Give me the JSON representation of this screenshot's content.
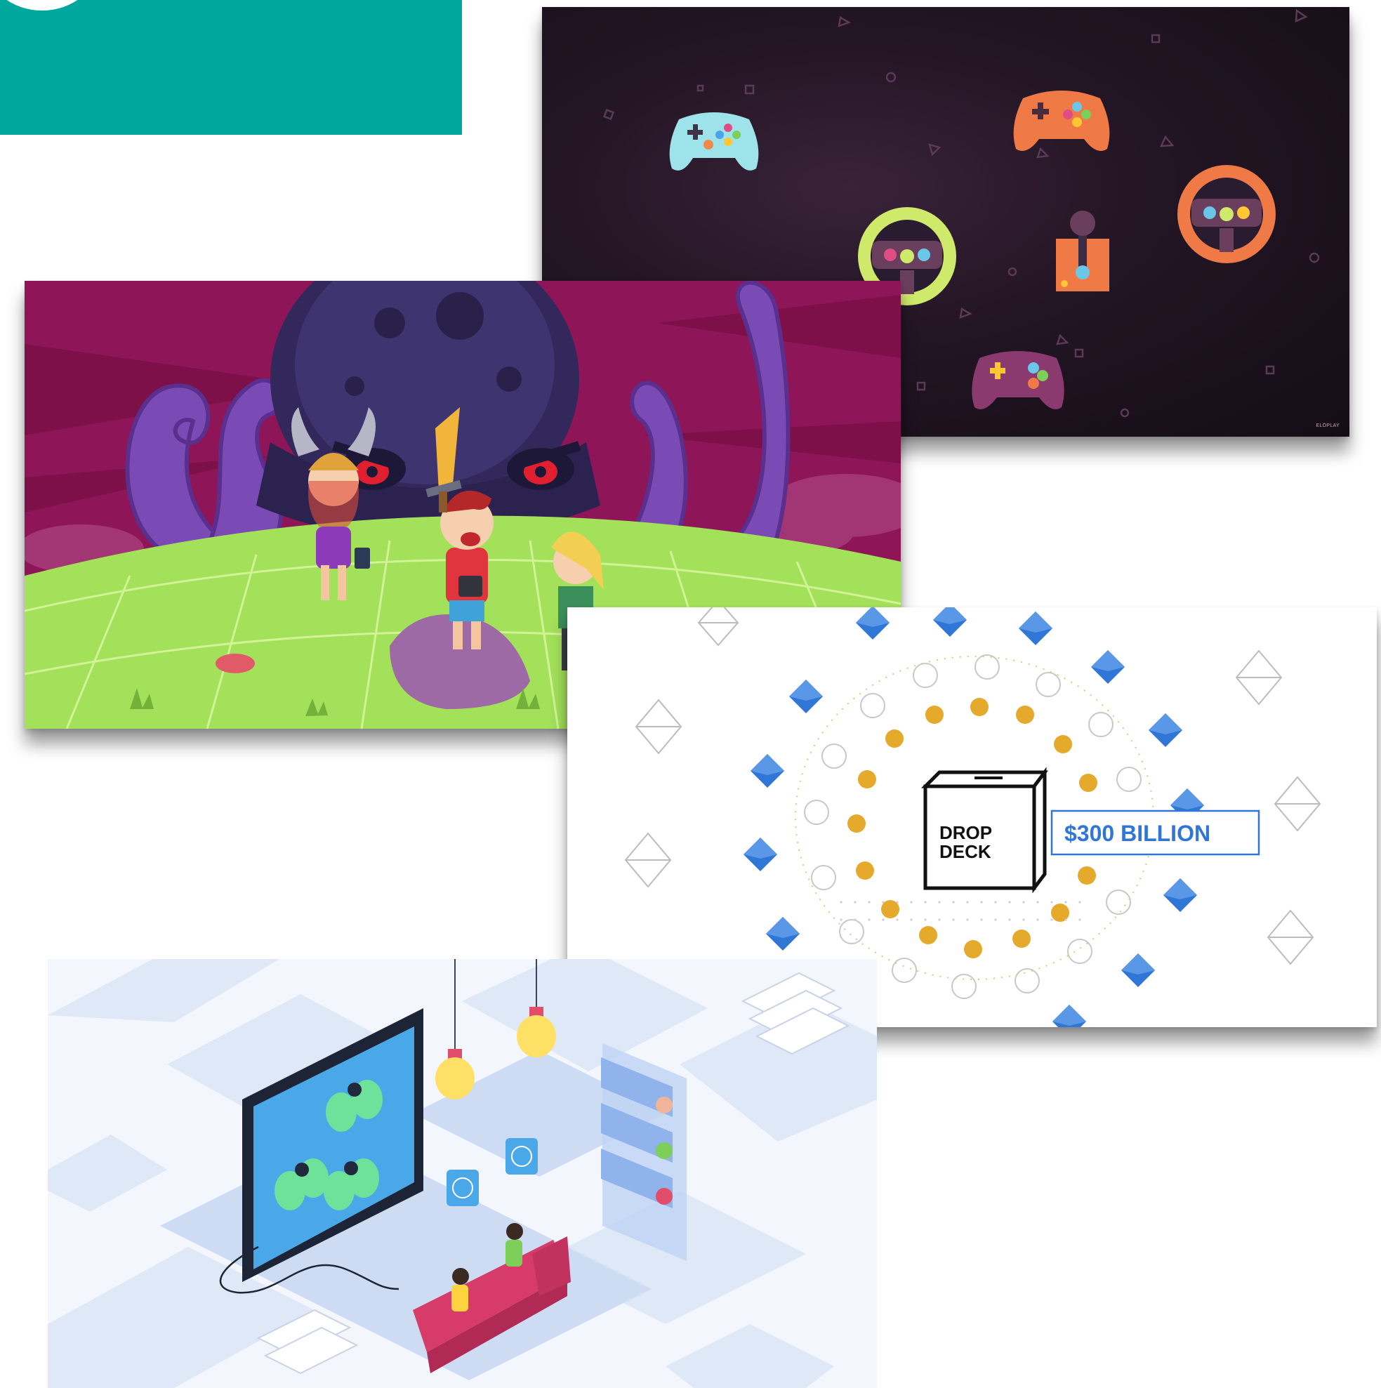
{
  "collage": {
    "colors": {
      "teal": "#00A79D",
      "gaming_bg": "#1b1220",
      "octopus_bg": "#8e1557",
      "grass": "#a3e15a",
      "diamond_blue": "#2f76d6",
      "coin_gold": "#e5a92b",
      "sofa_red": "#d63b6a"
    },
    "panels": [
      {
        "name": "gaming-controllers",
        "icons": [
          "gamepad-icon",
          "steering-wheel-icon",
          "joystick-icon"
        ]
      },
      {
        "name": "octopus-battle",
        "icons": [
          "octopus",
          "sword",
          "viking-helmet"
        ]
      },
      {
        "name": "drop-deck",
        "icons": [
          "box-logo",
          "ethereum-diamond-icon",
          "dollar-coin-icon"
        ]
      },
      {
        "name": "isometric-living-room",
        "icons": [
          "monitor-icon",
          "light-bulb-icon",
          "smiley-chat-icon",
          "sofa"
        ]
      }
    ]
  },
  "gaming": {
    "brand": "ELOPLAY"
  },
  "drop": {
    "logo_line1": "DROP",
    "logo_line2": "DECK",
    "amount": "$300 BILLION"
  }
}
